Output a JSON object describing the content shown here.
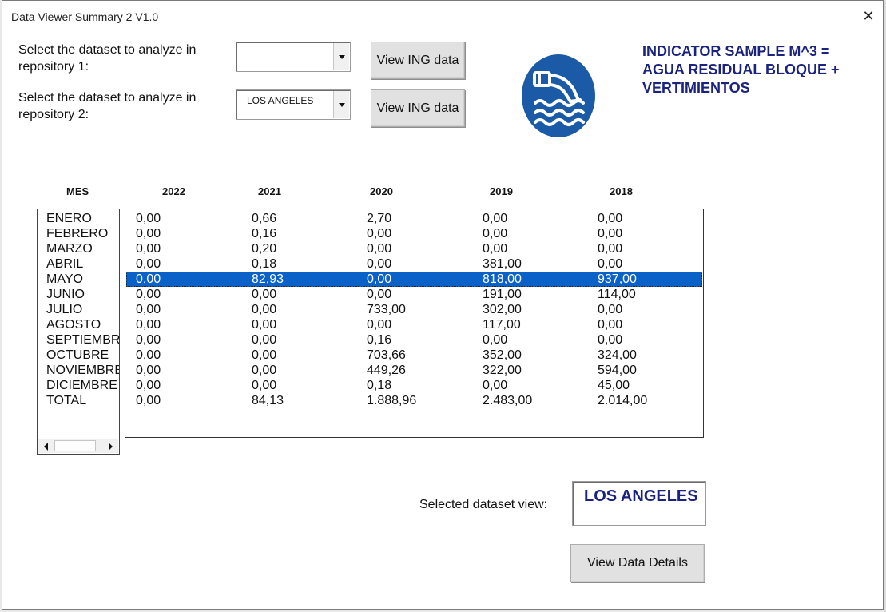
{
  "window": {
    "title": "Data Viewer Summary 2 V1.0",
    "close_glyph": "✕"
  },
  "repo1": {
    "label": "Select the dataset to analyze in repository 1:",
    "combo_value": "",
    "button_label": "View ING data"
  },
  "repo2": {
    "label": "Select the dataset to analyze in repository 2:",
    "combo_value": "LOS ANGELES",
    "button_label": "View ING data"
  },
  "indicator": {
    "title": "INDICATOR SAMPLE M^3 = AGUA RESIDUAL BLOQUE + VERTIMIENTOS",
    "icon": "wastewater-pipe-icon",
    "icon_color": "#1a5aa6"
  },
  "table": {
    "mes_header": "MES",
    "year_headers": [
      "2022",
      "2021",
      "2020",
      "2019",
      "2018"
    ],
    "months": [
      "ENERO",
      "FEBRERO",
      "MARZO",
      "ABRIL",
      "MAYO",
      "JUNIO",
      "JULIO",
      "AGOSTO",
      "SEPTIEMBRE",
      "OCTUBRE",
      "NOVIEMBRE",
      "DICIEMBRE",
      "TOTAL"
    ],
    "rows": [
      [
        "0,00",
        "0,66",
        "2,70",
        "0,00",
        "0,00"
      ],
      [
        "0,00",
        "0,16",
        "0,00",
        "0,00",
        "0,00"
      ],
      [
        "0,00",
        "0,20",
        "0,00",
        "0,00",
        "0,00"
      ],
      [
        "0,00",
        "0,18",
        "0,00",
        "381,00",
        "0,00"
      ],
      [
        "0,00",
        "82,93",
        "0,00",
        "818,00",
        "937,00"
      ],
      [
        "0,00",
        "0,00",
        "0,00",
        "191,00",
        "114,00"
      ],
      [
        "0,00",
        "0,00",
        "733,00",
        "302,00",
        "0,00"
      ],
      [
        "0,00",
        "0,00",
        "0,00",
        "117,00",
        "0,00"
      ],
      [
        "0,00",
        "0,00",
        "0,16",
        "0,00",
        "0,00"
      ],
      [
        "0,00",
        "0,00",
        "703,66",
        "352,00",
        "324,00"
      ],
      [
        "0,00",
        "0,00",
        "449,26",
        "322,00",
        "594,00"
      ],
      [
        "0,00",
        "0,00",
        "0,18",
        "0,00",
        "45,00"
      ],
      [
        "0,00",
        "84,13",
        "1.888,96",
        "2.483,00",
        "2.014,00"
      ]
    ],
    "selected_row_index": 4,
    "selected_row_color": "#0a62c9"
  },
  "selection": {
    "label": "Selected dataset view:",
    "value": "LOS ANGELES"
  },
  "details_button": {
    "label": "View Data Details"
  },
  "colors": {
    "heading_navy": "#1a237e"
  }
}
